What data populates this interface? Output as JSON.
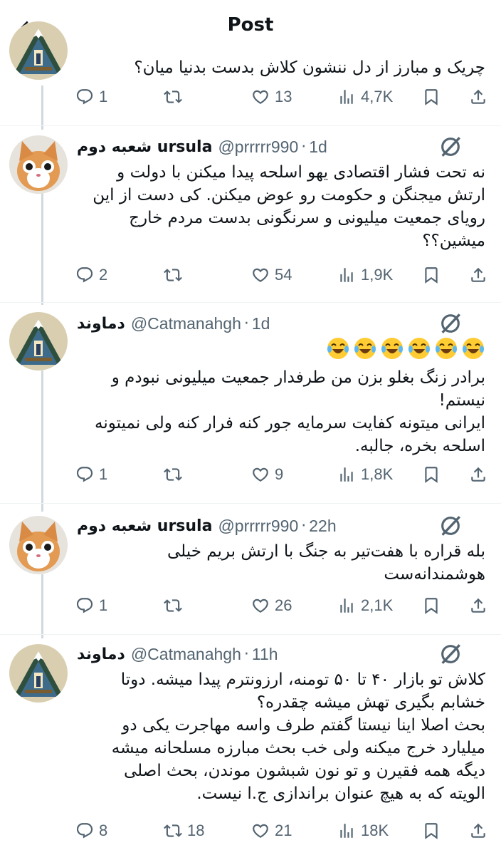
{
  "header": {
    "title": "Post"
  },
  "colors": {
    "text": "#0f1419",
    "muted": "#536471",
    "line": "#cfd9de",
    "divider": "#eff3f4"
  },
  "tweets": [
    {
      "name": "",
      "handle": "",
      "time": "",
      "avatar": "mountain-painting-avatar",
      "text": "چریک و مبارز از دل ننشون کلاش بدست بدنیا میان؟",
      "stats": {
        "replies": "1",
        "reposts": "",
        "likes": "13",
        "views": "4,7K"
      }
    },
    {
      "name": "شعبه دوم ursula",
      "handle": "@prrrrr990",
      "time": "1d",
      "avatar": "cat-face-avatar",
      "text": "نه تحت فشار اقتصادی یهو اسلحه پیدا میکنن با دولت و\nارتش میجنگن و حکومت رو عوض میکنن. کی دست از این\nرویای جمعیت میلیونی و سرنگونی بدست مردم خارج\nمیشین؟؟",
      "stats": {
        "replies": "2",
        "reposts": "",
        "likes": "54",
        "views": "1,9K"
      }
    },
    {
      "name": "دماوند",
      "handle": "@Catmanahgh",
      "time": "1d",
      "avatar": "mountain-painting-avatar",
      "emoji_count": 6,
      "text": "برادر زنگ بغلو بزن من طرفدار جمعیت میلیونی نبودم و\nنیستم!\nایرانی میتونه کفایت سرمایه جور کنه فرار کنه ولی نمیتونه\nاسلحه بخره، جالبه.",
      "stats": {
        "replies": "1",
        "reposts": "",
        "likes": "9",
        "views": "1,8K"
      }
    },
    {
      "name": "شعبه دوم ursula",
      "handle": "@prrrrr990",
      "time": "22h",
      "avatar": "cat-face-avatar",
      "text": "بله قراره با هفت‌تیر به جنگ با ارتش بریم خیلی\nهوشمندانه‌ست",
      "stats": {
        "replies": "1",
        "reposts": "",
        "likes": "26",
        "views": "2,1K"
      }
    },
    {
      "name": "دماوند",
      "handle": "@Catmanahgh",
      "time": "11h",
      "avatar": "mountain-painting-avatar",
      "text": "کلاش تو بازار ۴۰ تا ۵۰ تومنه، ارزونترم پیدا میشه. دوتا\nخشابم بگیری تهش میشه چقدره؟\nبحث اصلا اینا نیستا گفتم طرف واسه مهاجرت یکی دو\nمیلیارد خرج میکنه ولی خب بحث مبارزه مسلحانه میشه\nدیگه همه فقیرن و تو نون شبشون موندن، بحث اصلی\nالویته که به هیچ عنوان براندازی ج.ا نیست.",
      "stats": {
        "replies": "8",
        "reposts": "18",
        "likes": "21",
        "views": "18K"
      }
    }
  ]
}
